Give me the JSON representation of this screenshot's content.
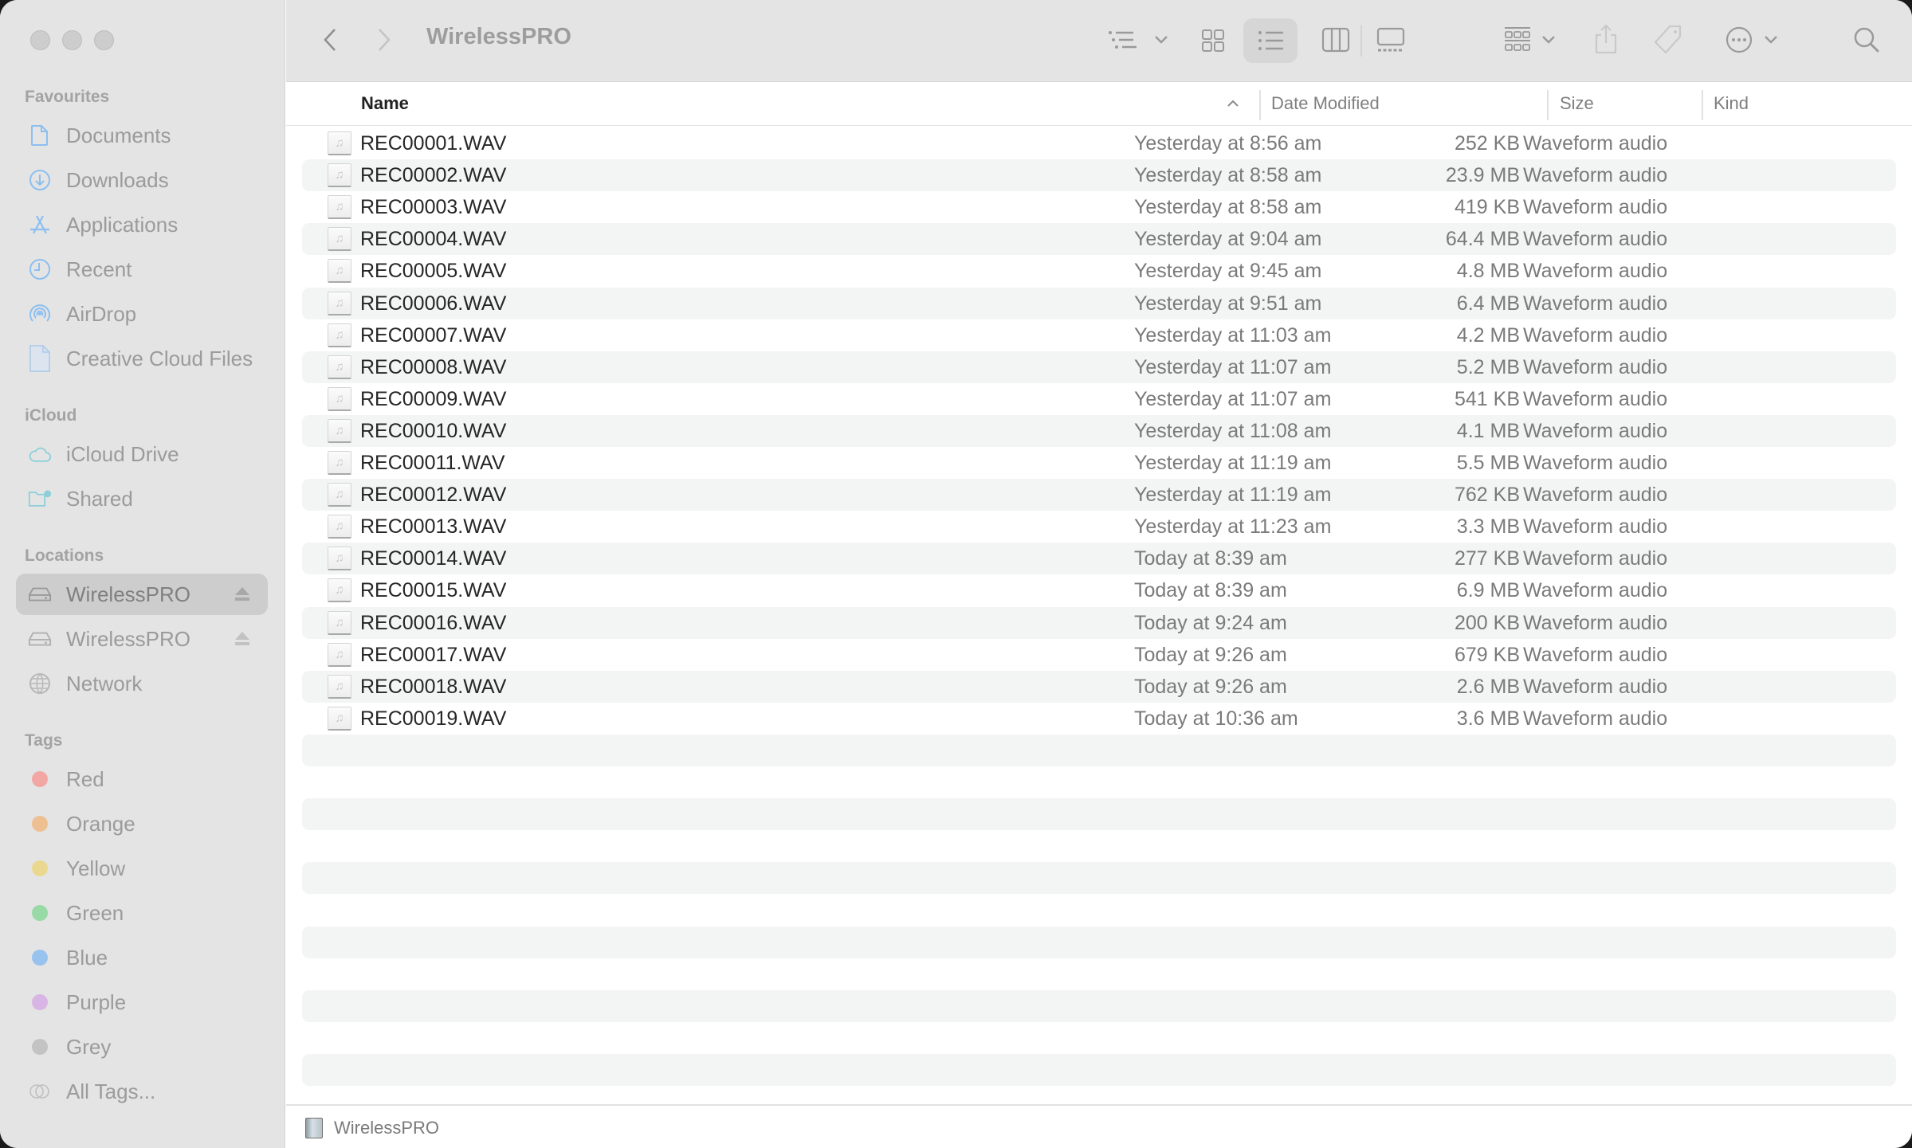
{
  "window": {
    "title": "WirelessPRO"
  },
  "sidebar": {
    "sections": [
      {
        "heading": "Favourites",
        "items": [
          {
            "label": "Documents",
            "icon": "document-icon"
          },
          {
            "label": "Downloads",
            "icon": "download-icon"
          },
          {
            "label": "Applications",
            "icon": "applications-icon"
          },
          {
            "label": "Recent",
            "icon": "clock-icon"
          },
          {
            "label": "AirDrop",
            "icon": "airdrop-icon"
          },
          {
            "label": "Creative Cloud Files",
            "icon": "file-icon"
          }
        ]
      },
      {
        "heading": "iCloud",
        "items": [
          {
            "label": "iCloud Drive",
            "icon": "cloud-icon"
          },
          {
            "label": "Shared",
            "icon": "shared-folder-icon"
          }
        ]
      },
      {
        "heading": "Locations",
        "items": [
          {
            "label": "WirelessPRO",
            "icon": "drive-icon",
            "selected": true,
            "ejectable": true
          },
          {
            "label": "WirelessPRO",
            "icon": "drive-icon",
            "ejectable": true
          },
          {
            "label": "Network",
            "icon": "globe-icon"
          }
        ]
      },
      {
        "heading": "Tags",
        "items": [
          {
            "label": "Red",
            "color": "#f3a7a5"
          },
          {
            "label": "Orange",
            "color": "#eec091"
          },
          {
            "label": "Yellow",
            "color": "#ead890"
          },
          {
            "label": "Green",
            "color": "#98daa6"
          },
          {
            "label": "Blue",
            "color": "#98c3ee"
          },
          {
            "label": "Purple",
            "color": "#d8b5e4"
          },
          {
            "label": "Grey",
            "color": "#c3c3c3"
          },
          {
            "label": "All Tags...",
            "icon": "all-tags-icon"
          }
        ]
      }
    ]
  },
  "toolbar": {
    "title": "WirelessPRO",
    "buttons": [
      "back",
      "forward",
      "sort-options",
      "icon-view",
      "list-view",
      "column-view",
      "gallery-view",
      "group",
      "share",
      "tags",
      "more",
      "search"
    ],
    "active_view": "list-view"
  },
  "columns": {
    "name": "Name",
    "date": "Date Modified",
    "size": "Size",
    "kind": "Kind"
  },
  "files": [
    {
      "name": "REC00001.WAV",
      "date": "Yesterday at 8:56 am",
      "size": "252 KB",
      "kind": "Waveform audio"
    },
    {
      "name": "REC00002.WAV",
      "date": "Yesterday at 8:58 am",
      "size": "23.9 MB",
      "kind": "Waveform audio"
    },
    {
      "name": "REC00003.WAV",
      "date": "Yesterday at 8:58 am",
      "size": "419 KB",
      "kind": "Waveform audio"
    },
    {
      "name": "REC00004.WAV",
      "date": "Yesterday at 9:04 am",
      "size": "64.4 MB",
      "kind": "Waveform audio"
    },
    {
      "name": "REC00005.WAV",
      "date": "Yesterday at 9:45 am",
      "size": "4.8 MB",
      "kind": "Waveform audio"
    },
    {
      "name": "REC00006.WAV",
      "date": "Yesterday at 9:51 am",
      "size": "6.4 MB",
      "kind": "Waveform audio"
    },
    {
      "name": "REC00007.WAV",
      "date": "Yesterday at 11:03 am",
      "size": "4.2 MB",
      "kind": "Waveform audio"
    },
    {
      "name": "REC00008.WAV",
      "date": "Yesterday at 11:07 am",
      "size": "5.2 MB",
      "kind": "Waveform audio"
    },
    {
      "name": "REC00009.WAV",
      "date": "Yesterday at 11:07 am",
      "size": "541 KB",
      "kind": "Waveform audio"
    },
    {
      "name": "REC00010.WAV",
      "date": "Yesterday at 11:08 am",
      "size": "4.1 MB",
      "kind": "Waveform audio"
    },
    {
      "name": "REC00011.WAV",
      "date": "Yesterday at 11:19 am",
      "size": "5.5 MB",
      "kind": "Waveform audio"
    },
    {
      "name": "REC00012.WAV",
      "date": "Yesterday at 11:19 am",
      "size": "762 KB",
      "kind": "Waveform audio"
    },
    {
      "name": "REC00013.WAV",
      "date": "Yesterday at 11:23 am",
      "size": "3.3 MB",
      "kind": "Waveform audio"
    },
    {
      "name": "REC00014.WAV",
      "date": "Today at 8:39 am",
      "size": "277 KB",
      "kind": "Waveform audio"
    },
    {
      "name": "REC00015.WAV",
      "date": "Today at 8:39 am",
      "size": "6.9 MB",
      "kind": "Waveform audio"
    },
    {
      "name": "REC00016.WAV",
      "date": "Today at 9:24 am",
      "size": "200 KB",
      "kind": "Waveform audio"
    },
    {
      "name": "REC00017.WAV",
      "date": "Today at 9:26 am",
      "size": "679 KB",
      "kind": "Waveform audio"
    },
    {
      "name": "REC00018.WAV",
      "date": "Today at 9:26 am",
      "size": "2.6 MB",
      "kind": "Waveform audio"
    },
    {
      "name": "REC00019.WAV",
      "date": "Today at 10:36 am",
      "size": "3.6 MB",
      "kind": "Waveform audio"
    }
  ],
  "statusbar": {
    "path": "WirelessPRO"
  }
}
